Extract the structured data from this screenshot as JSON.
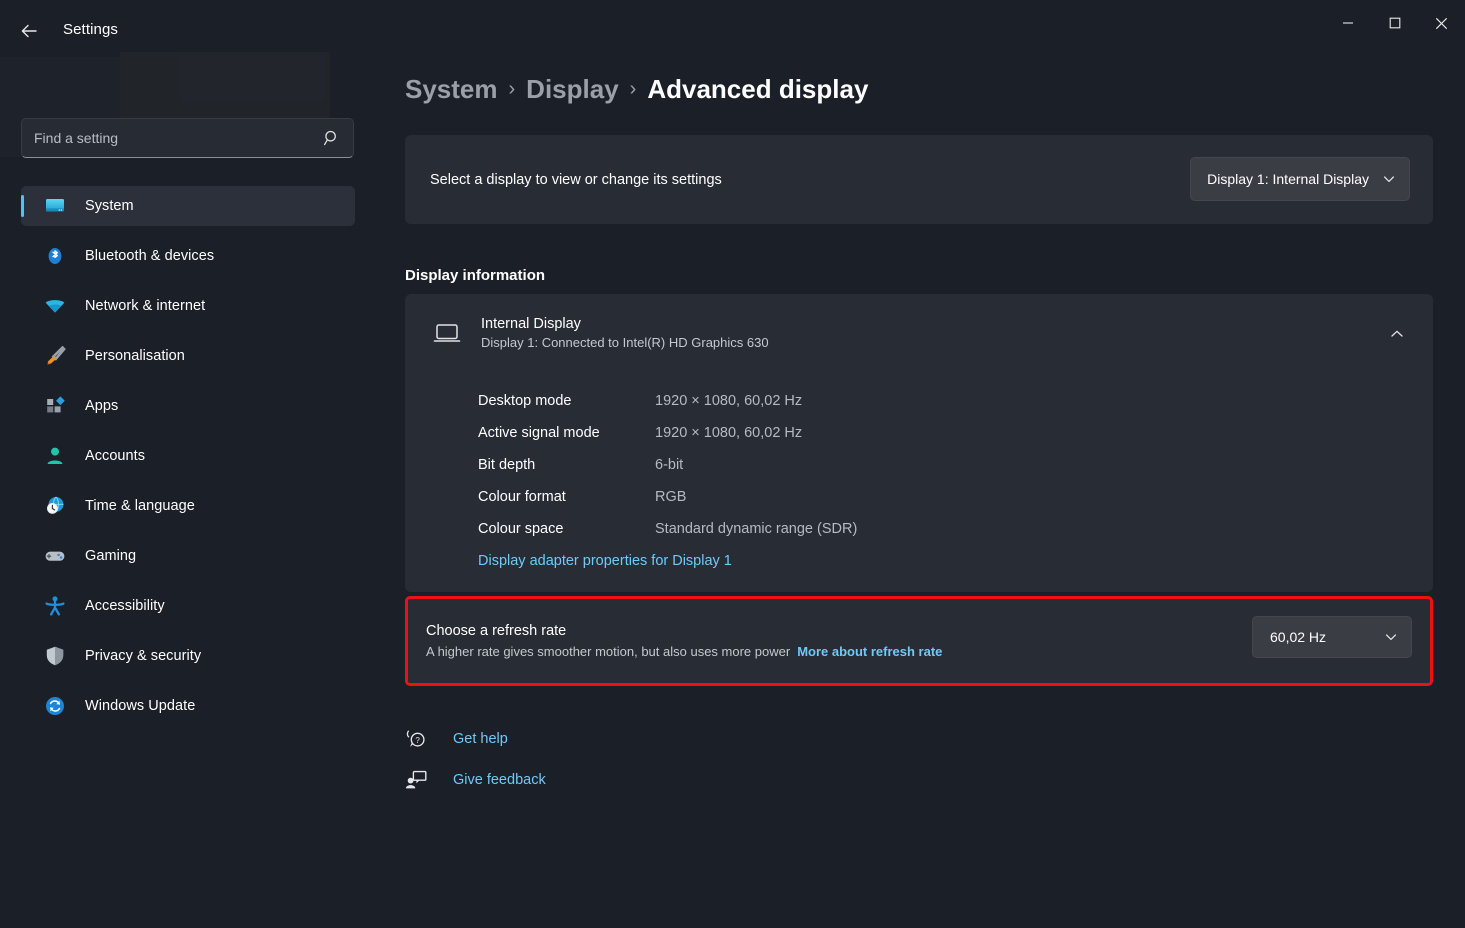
{
  "window": {
    "app_title": "Settings",
    "back_icon": "back-arrow-icon",
    "minimize_label": "—",
    "maximize_label": "☐",
    "close_label": "✕"
  },
  "search": {
    "placeholder": "Find a setting",
    "value": "",
    "icon": "search-icon"
  },
  "sidebar": {
    "items": [
      {
        "label": "System",
        "icon": "monitor-icon",
        "active": true
      },
      {
        "label": "Bluetooth & devices",
        "icon": "bluetooth-icon",
        "active": false
      },
      {
        "label": "Network & internet",
        "icon": "wifi-icon",
        "active": false
      },
      {
        "label": "Personalisation",
        "icon": "paintbrush-icon",
        "active": false
      },
      {
        "label": "Apps",
        "icon": "apps-icon",
        "active": false
      },
      {
        "label": "Accounts",
        "icon": "person-icon",
        "active": false
      },
      {
        "label": "Time & language",
        "icon": "clock-globe-icon",
        "active": false
      },
      {
        "label": "Gaming",
        "icon": "gamepad-icon",
        "active": false
      },
      {
        "label": "Accessibility",
        "icon": "accessibility-icon",
        "active": false
      },
      {
        "label": "Privacy & security",
        "icon": "shield-icon",
        "active": false
      },
      {
        "label": "Windows Update",
        "icon": "refresh-circle-icon",
        "active": false
      }
    ]
  },
  "breadcrumb": {
    "root": "System",
    "parent": "Display",
    "current": "Advanced display",
    "separator": "›"
  },
  "display_selector": {
    "label": "Select a display to view or change its settings",
    "selected": "Display 1: Internal Display"
  },
  "display_information": {
    "section_title": "Display information",
    "name": "Internal Display",
    "subtitle": "Display 1: Connected to Intel(R) HD Graphics 630",
    "expanded": true,
    "rows": [
      {
        "key": "Desktop mode",
        "value": "1920 × 1080, 60,02 Hz"
      },
      {
        "key": "Active signal mode",
        "value": "1920 × 1080, 60,02 Hz"
      },
      {
        "key": "Bit depth",
        "value": "6-bit"
      },
      {
        "key": "Colour format",
        "value": "RGB"
      },
      {
        "key": "Colour space",
        "value": "Standard dynamic range (SDR)"
      }
    ],
    "adapter_link": "Display adapter properties for Display 1"
  },
  "refresh_rate": {
    "title": "Choose a refresh rate",
    "description": "A higher rate gives smoother motion, but also uses more power",
    "learn_more": "More about refresh rate",
    "selected": "60,02 Hz",
    "highlight_color": "#ee1111"
  },
  "footer_links": [
    {
      "label": "Get help",
      "icon": "help-bubble-icon"
    },
    {
      "label": "Give feedback",
      "icon": "feedback-person-icon"
    }
  ],
  "colors": {
    "accent": "#4cc2ff",
    "link": "#71c9f8",
    "window_bg": "#1b1f27",
    "card_bg": "#282c34"
  }
}
